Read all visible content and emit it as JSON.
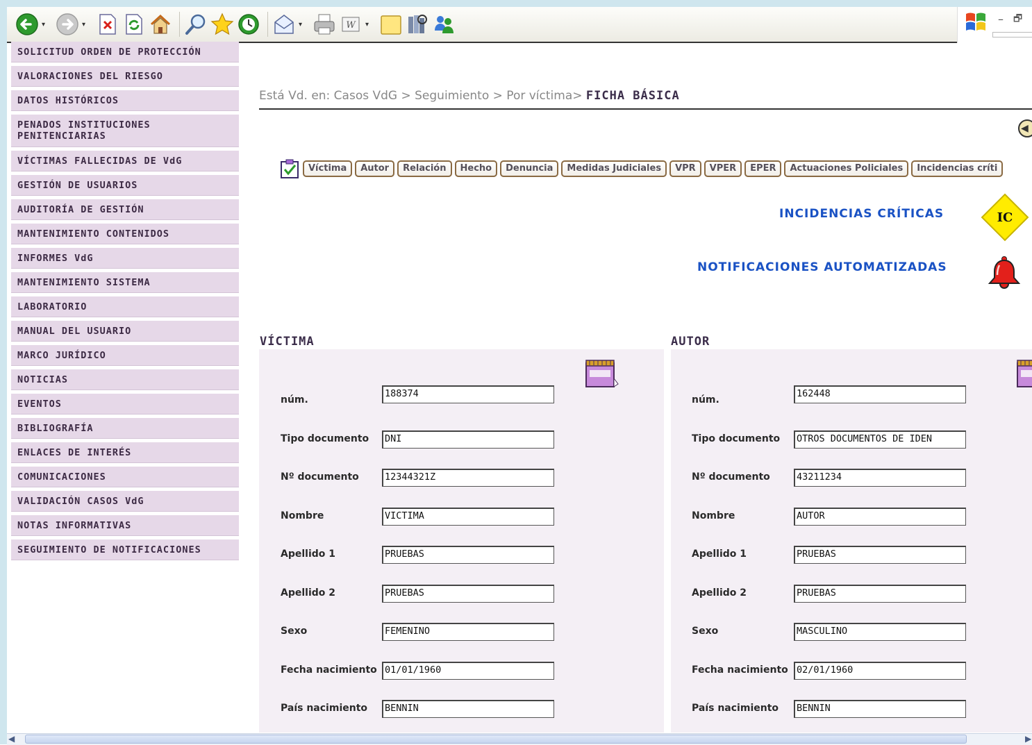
{
  "sidebar": {
    "items": [
      "SOLICITUD ORDEN DE PROTECCIÓN",
      "VALORACIONES DEL RIESGO",
      "DATOS HISTÓRICOS",
      "PENADOS INSTITUCIONES PENITENCIARIAS",
      "VÍCTIMAS FALLECIDAS DE VdG",
      "GESTIÓN DE USUARIOS",
      "AUDITORÍA DE GESTIÓN",
      "MANTENIMIENTO CONTENIDOS",
      "INFORMES VdG",
      "MANTENIMIENTO SISTEMA",
      "LABORATORIO",
      "MANUAL DEL USUARIO",
      "MARCO JURÍDICO",
      "NOTICIAS",
      "EVENTOS",
      "BIBLIOGRAFÍA",
      "ENLACES DE INTERÉS",
      "COMUNICACIONES",
      "VALIDACIÓN CASOS VdG",
      "NOTAS INFORMATIVAS",
      "SEGUIMIENTO DE NOTIFICACIONES"
    ]
  },
  "breadcrumb": {
    "prefix": "Está Vd. en: Casos VdG > Seguimiento > Por víctima> ",
    "current": "FICHA BÁSICA"
  },
  "tabs": [
    "Víctima",
    "Autor",
    "Relación",
    "Hecho",
    "Denuncia",
    "Medidas Judiciales",
    "VPR",
    "VPER",
    "EPER",
    "Actuaciones Policiales",
    "Incidencias críti"
  ],
  "alerts": {
    "incidencias_label": "INCIDENCIAS CRÍTICAS",
    "ic_badge": "IC",
    "notificaciones_label": "NOTIFICACIONES AUTOMATIZADAS"
  },
  "victima": {
    "title": "VÍCTIMA",
    "labels": {
      "num": "núm.",
      "tipo_documento": "Tipo documento",
      "n_documento": "Nº documento",
      "nombre": "Nombre",
      "apellido1": "Apellido 1",
      "apellido2": "Apellido 2",
      "sexo": "Sexo",
      "fecha_nacimiento": "Fecha nacimiento",
      "pais_nacimiento": "País nacimiento"
    },
    "values": {
      "num": "188374",
      "tipo_documento": "DNI",
      "n_documento": "12344321Z",
      "nombre": "VICTIMA",
      "apellido1": "PRUEBAS",
      "apellido2": "PRUEBAS",
      "sexo": "FEMENINO",
      "fecha_nacimiento": "01/01/1960",
      "pais_nacimiento": "BENNIN"
    }
  },
  "autor": {
    "title": "AUTOR",
    "labels": {
      "num": "núm.",
      "tipo_documento": "Tipo documento",
      "n_documento": "Nº documento",
      "nombre": "Nombre",
      "apellido1": "Apellido 1",
      "apellido2": "Apellido 2",
      "sexo": "Sexo",
      "fecha_nacimiento": "Fecha nacimiento",
      "pais_nacimiento": "País nacimiento"
    },
    "values": {
      "num": "162448",
      "tipo_documento": "OTROS DOCUMENTOS DE IDEN",
      "n_documento": "43211234",
      "nombre": "AUTOR",
      "apellido1": "PRUEBAS",
      "apellido2": "PRUEBAS",
      "sexo": "MASCULINO",
      "fecha_nacimiento": "02/01/1960",
      "pais_nacimiento": "BENNIN"
    }
  },
  "colors": {
    "sidebar_bg": "#e6d8e8",
    "panel_bg": "#f4eff5",
    "link_blue": "#1a52c4",
    "ic_yellow": "#ffec00",
    "bell_red": "#e3201b"
  },
  "icons": {
    "toolbar": [
      "back-icon",
      "forward-icon",
      "stop-icon",
      "refresh-icon",
      "home-icon",
      "search-icon",
      "favorites-icon",
      "history-icon",
      "mail-icon",
      "print-icon",
      "word-icon",
      "folder-icon",
      "research-icon",
      "messenger-icon"
    ]
  }
}
